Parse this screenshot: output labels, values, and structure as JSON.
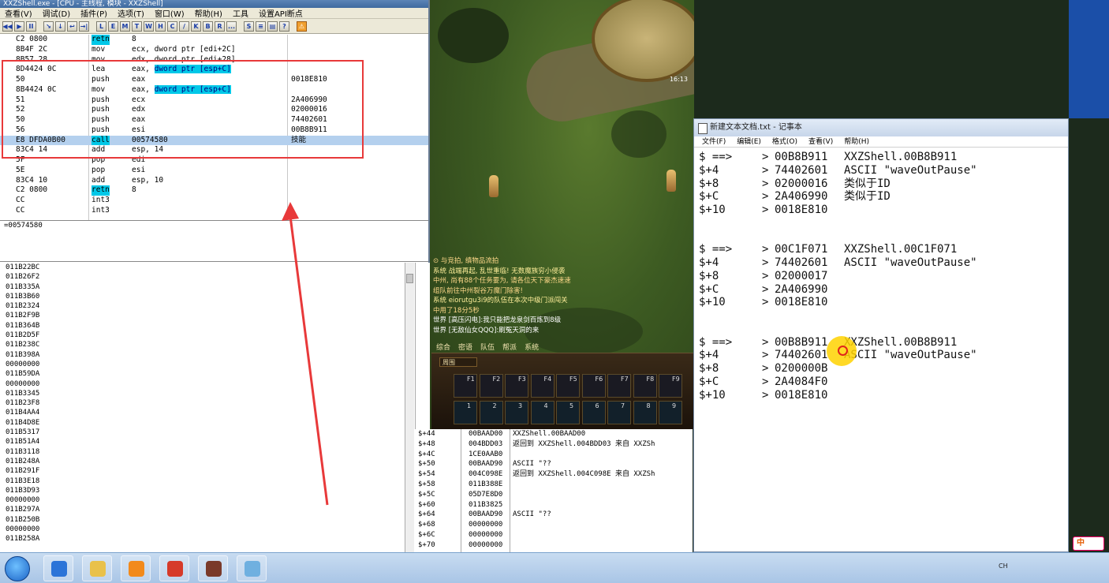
{
  "debugger": {
    "title": "XXZShell.exe - [CPU - 主线程, 模块 - XXZShell]",
    "menu": [
      "查看(V)",
      "调试(D)",
      "插件(P)",
      "选项(T)",
      "窗口(W)",
      "帮助(H)",
      "工具",
      "设置API断点"
    ],
    "toolbar": [
      "◀◀",
      "▶",
      "II",
      "↘",
      "↓",
      "↩",
      "→|",
      "L",
      "E",
      "M",
      "T",
      "W",
      "H",
      "C",
      "/",
      "K",
      "B",
      "R",
      "...",
      "S",
      "≡",
      "▤",
      "?",
      "⚠"
    ],
    "cpu_rows": [
      {
        "hex": "C2 0800",
        "mn": "retn",
        "op": "8",
        "cm": "",
        "mn_hl": true
      },
      {
        "hex": "8B4F 2C",
        "mn": "mov",
        "op": "ecx, dword ptr [edi+2C]",
        "cm": ""
      },
      {
        "hex": "8B57 28",
        "mn": "mov",
        "op": "edx, dword ptr [edi+28]",
        "cm": ""
      },
      {
        "hex": "8D4424 0C",
        "mn": "lea",
        "op_pre": "eax, ",
        "op": "dword ptr [esp+C]",
        "cm": "",
        "op_hl": true
      },
      {
        "hex": "50",
        "mn": "push",
        "op": "eax",
        "cm": "0018E810"
      },
      {
        "hex": "8B4424 0C",
        "mn": "mov",
        "op_pre": "eax, ",
        "op": "dword ptr [esp+C]",
        "cm": "",
        "op_hl": true
      },
      {
        "hex": "51",
        "mn": "push",
        "op": "ecx",
        "cm": "2A406990"
      },
      {
        "hex": "52",
        "mn": "push",
        "op": "edx",
        "cm": "02000016"
      },
      {
        "hex": "50",
        "mn": "push",
        "op": "eax",
        "cm": "74402601"
      },
      {
        "hex": "56",
        "mn": "push",
        "op": "esi",
        "cm": "00B8B911"
      },
      {
        "hex": "E8 DFDA0B00",
        "mn": "call",
        "op": "00574580",
        "cm": "技能",
        "sel": true,
        "mn_hl": true
      },
      {
        "hex": "83C4 14",
        "mn": "add",
        "op": "esp, 14",
        "cm": ""
      },
      {
        "hex": "5F",
        "mn": "pop",
        "op": "edi",
        "cm": ""
      },
      {
        "hex": "5E",
        "mn": "pop",
        "op": "esi",
        "cm": ""
      },
      {
        "hex": "83C4 10",
        "mn": "add",
        "op": "esp, 10",
        "cm": ""
      },
      {
        "hex": "C2 0800",
        "mn": "retn",
        "op": "8",
        "cm": "",
        "mn_hl": true
      },
      {
        "hex": "CC",
        "mn": "int3",
        "op": "",
        "cm": ""
      },
      {
        "hex": "CC",
        "mn": "int3",
        "op": "",
        "cm": ""
      }
    ],
    "info_line": "=00574580",
    "stack_left": [
      "011B22BC",
      "011B26F2",
      "011B335A",
      "011B3B60",
      "011B2324",
      "011B2F9B",
      "011B364B",
      "011B2D5F",
      "011B238C",
      "011B398A",
      "00000000",
      "011B59DA",
      "00000000",
      "011B3345",
      "011B23F8",
      "011B4AA4",
      "011B4D8E",
      "011B5317",
      "011B51A4",
      "011B3118",
      "011B248A",
      "011B291F",
      "011B3E18",
      "011B3D93",
      "00000000",
      "011B297A",
      "011B250B",
      "00000000",
      "011B258A"
    ]
  },
  "stack_mid": [
    {
      "a": "$+44",
      "b": "00BAAD00",
      "c": "XXZShell.00BAAD00"
    },
    {
      "a": "$+48",
      "b": "004BDD03",
      "c": "返回到 XXZShell.004BDD03 来自 XXZSh"
    },
    {
      "a": "$+4C",
      "b": "1CE0AAB0",
      "c": ""
    },
    {
      "a": "$+50",
      "b": "00BAAD90",
      "c": "ASCII \"??"
    },
    {
      "a": "$+54",
      "b": "004C098E",
      "c": "返回到 XXZShell.004C098E 来自 XXZSh"
    },
    {
      "a": "$+58",
      "b": "011B388E",
      "c": ""
    },
    {
      "a": "$+5C",
      "b": "05D7E8D0",
      "c": ""
    },
    {
      "a": "$+60",
      "b": "011B3825",
      "c": ""
    },
    {
      "a": "$+64",
      "b": "00BAAD90",
      "c": "ASCII \"??"
    },
    {
      "a": "$+68",
      "b": "00000000",
      "c": ""
    },
    {
      "a": "$+6C",
      "b": "00000000",
      "c": ""
    },
    {
      "a": "$+70",
      "b": "00000000",
      "c": ""
    }
  ],
  "game": {
    "chat": [
      {
        "cls": "",
        "text": "⊙ 与竞拍, 缜物品流拍"
      },
      {
        "cls": "sys",
        "text": "系统 战端再起, 乱世重临! 无数魔族穷小侵袭"
      },
      {
        "cls": "",
        "text": "中州, 尚有88个任务要为, 请各位天下豪杰速速"
      },
      {
        "cls": "",
        "text": "组队前往中州裂谷万魔门除害!"
      },
      {
        "cls": "sys",
        "text": "系统 eiorutgu3i9的队伍在本次中级门派闯关"
      },
      {
        "cls": "",
        "text": "中用了18分5秒"
      },
      {
        "cls": "world",
        "text": "世界 [高压闪电]:我只能把龙泉剑百炼到8级"
      },
      {
        "cls": "world",
        "text": "世界 [无敌仙女QQQ]:刷冤天洞的来"
      }
    ],
    "chat_tabs": [
      "综合",
      "密语",
      "队伍",
      "帮派",
      "系统"
    ],
    "hotbar_select": "周围",
    "fkeys": [
      "F1",
      "F2",
      "F3",
      "F4",
      "F5",
      "F6",
      "F7",
      "F8",
      "F9"
    ],
    "nkeys": [
      "1",
      "2",
      "3",
      "4",
      "5",
      "6",
      "7",
      "8",
      "9"
    ],
    "minimap_time": "16:13"
  },
  "notepad": {
    "title": "新建文本文档.txt - 记事本",
    "menu": [
      "文件(F)",
      "编辑(E)",
      "格式(O)",
      "查看(V)",
      "帮助(H)"
    ],
    "lines": [
      {
        "l": "$ ==>",
        "m": ">",
        "v": "00B8B911",
        "d": "XXZShell.00B8B911"
      },
      {
        "l": "$+4",
        "m": ">",
        "v": "74402601",
        "d": "ASCII \"waveOutPause\""
      },
      {
        "l": "$+8",
        "m": ">",
        "v": "02000016",
        "d": "类似于ID"
      },
      {
        "l": "$+C",
        "m": ">",
        "v": "2A406990",
        "d": "类似于ID"
      },
      {
        "l": "$+10",
        "m": ">",
        "v": "0018E810",
        "d": ""
      },
      {
        "l": "",
        "m": "",
        "v": "",
        "d": ""
      },
      {
        "l": "",
        "m": "",
        "v": "",
        "d": ""
      },
      {
        "l": "$ ==>",
        "m": ">",
        "v": "00C1F071",
        "d": "XXZShell.00C1F071"
      },
      {
        "l": "$+4",
        "m": ">",
        "v": "74402601",
        "d": "ASCII \"waveOutPause\""
      },
      {
        "l": "$+8",
        "m": ">",
        "v": "02000017",
        "d": ""
      },
      {
        "l": "$+C",
        "m": ">",
        "v": "2A406990",
        "d": ""
      },
      {
        "l": "$+10",
        "m": ">",
        "v": "0018E810",
        "d": ""
      },
      {
        "l": "",
        "m": "",
        "v": "",
        "d": ""
      },
      {
        "l": "",
        "m": "",
        "v": "",
        "d": ""
      },
      {
        "l": "$ ==>",
        "m": ">",
        "v": "00B8B911",
        "d": "XXZShell.00B8B911"
      },
      {
        "l": "$+4",
        "m": ">",
        "v": "74402601",
        "d": "ASCII \"waveOutPause\""
      },
      {
        "l": "$+8",
        "m": ">",
        "v": "0200000B",
        "d": ""
      },
      {
        "l": "$+C",
        "m": ">",
        "v": "2A4084F0",
        "d": ""
      },
      {
        "l": "$+10",
        "m": ">",
        "v": "0018E810",
        "d": ""
      }
    ]
  },
  "taskbar": {
    "ime_label": "中",
    "tray_text": "CH"
  },
  "colors": {
    "highlight_box": "#e8393a",
    "cyan_hl": "#00c8e8",
    "selection": "#b4d0ee"
  }
}
